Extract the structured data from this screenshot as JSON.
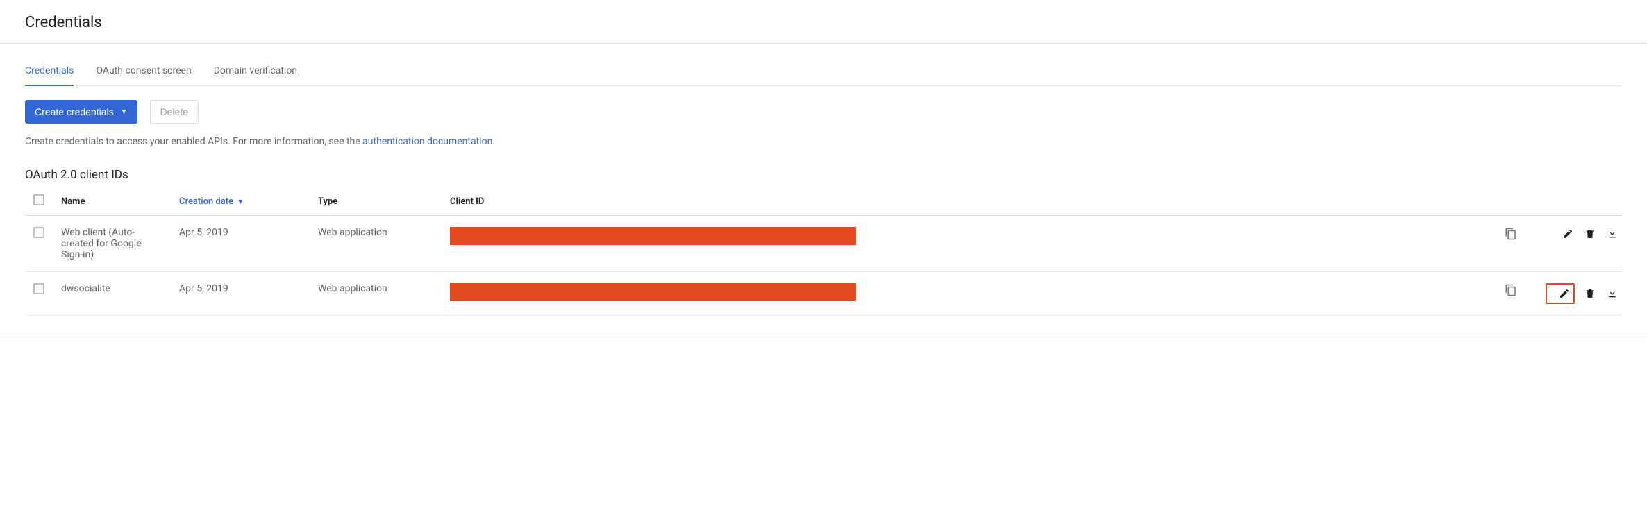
{
  "page": {
    "title": "Credentials"
  },
  "tabs": [
    {
      "label": "Credentials",
      "active": true
    },
    {
      "label": "OAuth consent screen",
      "active": false
    },
    {
      "label": "Domain verification",
      "active": false
    }
  ],
  "buttons": {
    "create": "Create credentials",
    "delete": "Delete"
  },
  "info": {
    "text_pre": "Create credentials to access your enabled APIs. For more information, see the ",
    "link": "authentication documentation",
    "text_post": "."
  },
  "section": {
    "title": "OAuth 2.0 client IDs"
  },
  "columns": {
    "name": "Name",
    "creation_date": "Creation date",
    "type": "Type",
    "client_id": "Client ID"
  },
  "rows": [
    {
      "name": "Web client (Auto-created for Google Sign-in)",
      "creation_date": "Apr 5, 2019",
      "type": "Web application",
      "client_id_redacted": true,
      "edit_highlight": false
    },
    {
      "name": "dwsocialite",
      "creation_date": "Apr 5, 2019",
      "type": "Web application",
      "client_id_redacted": true,
      "edit_highlight": true
    }
  ],
  "icons": {
    "copy": "copy-icon",
    "edit": "pencil-icon",
    "delete": "trash-icon",
    "download": "download-icon",
    "chevron_down": "chevron-down-icon",
    "caret_down": "caret-down-icon"
  },
  "colors": {
    "primary": "#3367d6",
    "redact": "#e4481d"
  }
}
